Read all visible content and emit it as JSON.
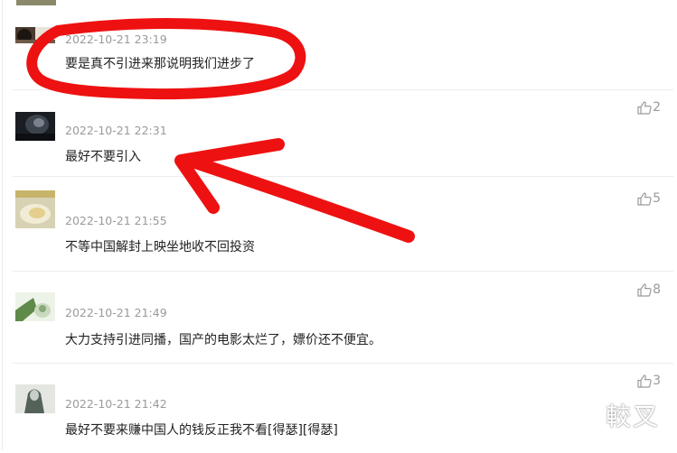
{
  "comments": [
    {
      "time": "2022-10-21 23:19",
      "text": "要是真不引进来那说明我们进步了",
      "likes": "",
      "avatar_icon": "dark-photo-avatar"
    },
    {
      "time": "2022-10-21 22:31",
      "text": "最好不要引入",
      "likes": "2",
      "avatar_icon": "dark-portrait-avatar"
    },
    {
      "time": "2022-10-21 21:55",
      "text": "不等中国解封上映坐地收不回投资",
      "likes": "5",
      "avatar_icon": "food-photo-avatar"
    },
    {
      "time": "2022-10-21 21:49",
      "text": "大力支持引进同播，国产的电影太烂了，嫖价还不便宜。",
      "likes": "8",
      "avatar_icon": "green-portrait-avatar"
    },
    {
      "time": "2022-10-21 21:42",
      "text": "最好不要来赚中国人的钱反正我不看[得瑟][得瑟]",
      "likes": "3",
      "avatar_icon": "grey-portrait-avatar"
    }
  ],
  "watermark": "較叉",
  "colors": {
    "annotation_red": "#ee1111",
    "timestamp_gray": "#9a9a9a",
    "text_dark": "#222222",
    "divider": "#ececec"
  },
  "icons": {
    "like": "thumbs-up-icon"
  }
}
